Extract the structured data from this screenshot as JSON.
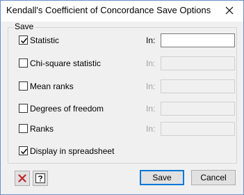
{
  "window": {
    "title": "Kendall's Coefficient of Concordance Save Options"
  },
  "group": {
    "label": "Save"
  },
  "options": [
    {
      "label": "Statistic",
      "checked": true,
      "in_label": "In:",
      "in_enabled": true,
      "in_value": ""
    },
    {
      "label": "Chi-square statistic",
      "checked": false,
      "in_label": "In:",
      "in_enabled": false,
      "in_value": ""
    },
    {
      "label": "Mean ranks",
      "checked": false,
      "in_label": "In:",
      "in_enabled": false,
      "in_value": ""
    },
    {
      "label": "Degrees of freedom",
      "checked": false,
      "in_label": "In:",
      "in_enabled": false,
      "in_value": ""
    },
    {
      "label": "Ranks",
      "checked": false,
      "in_label": "In:",
      "in_enabled": false,
      "in_value": ""
    }
  ],
  "display_in_spreadsheet": {
    "label": "Display in spreadsheet",
    "checked": true
  },
  "buttons": {
    "save_label": "Save",
    "cancel_label": "Cancel",
    "clear_icon": "red-x-icon",
    "help_icon": "help-question-icon"
  },
  "colors": {
    "clear_icon": "#c0282d",
    "default_button_border": "#0078d7"
  }
}
